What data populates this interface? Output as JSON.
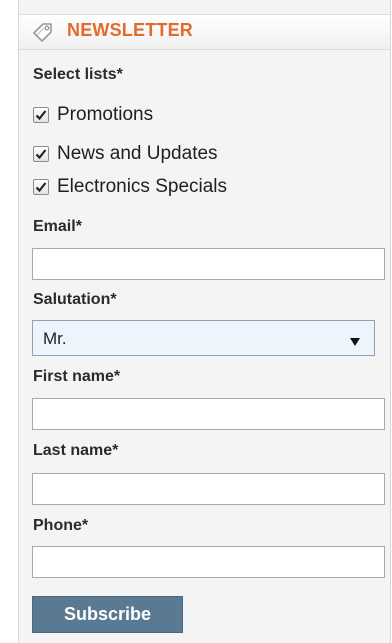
{
  "widget": {
    "title": "NEWSLETTER",
    "title_icon": "tag-icon",
    "accent_color": "#e26b2b",
    "button_color": "#5a7a93"
  },
  "lists": {
    "label": "Select lists*",
    "items": [
      {
        "label": "Promotions",
        "checked": true
      },
      {
        "label": "News and Updates",
        "checked": true
      },
      {
        "label": "Electronics Specials",
        "checked": true
      }
    ]
  },
  "fields": {
    "email": {
      "label": "Email*",
      "value": ""
    },
    "salutation": {
      "label": "Salutation*",
      "selected": "Mr."
    },
    "first_name": {
      "label": "First name*",
      "value": ""
    },
    "last_name": {
      "label": "Last name*",
      "value": ""
    },
    "phone": {
      "label": "Phone*",
      "value": ""
    }
  },
  "subscribe_label": "Subscribe"
}
